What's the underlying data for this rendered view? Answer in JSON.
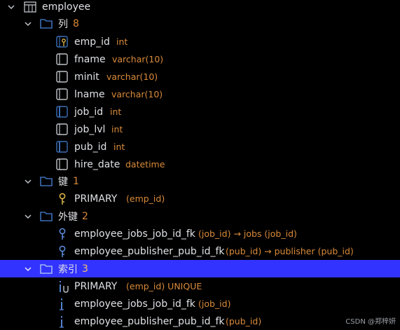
{
  "tree": {
    "table": {
      "name": "employee"
    },
    "columns_group": {
      "label": "列",
      "count": "8",
      "items": [
        {
          "name": "emp_id",
          "type": "int"
        },
        {
          "name": "fname",
          "type": "varchar(10)"
        },
        {
          "name": "minit",
          "type": "varchar(10)"
        },
        {
          "name": "lname",
          "type": "varchar(10)"
        },
        {
          "name": "job_id",
          "type": "int"
        },
        {
          "name": "job_lvl",
          "type": "int"
        },
        {
          "name": "pub_id",
          "type": "int"
        },
        {
          "name": "hire_date",
          "type": "datetime"
        }
      ]
    },
    "keys_group": {
      "label": "键",
      "count": "1",
      "items": [
        {
          "name": "PRIMARY",
          "detail": "(emp_id)"
        }
      ]
    },
    "fks_group": {
      "label": "外键",
      "count": "2",
      "items": [
        {
          "name": "employee_jobs_job_id_fk",
          "detail": "(job_id) → jobs (job_id)"
        },
        {
          "name": "employee_publisher_pub_id_fk",
          "detail": "(pub_id) → publisher (pub_id)"
        }
      ]
    },
    "indexes_group": {
      "label": "索引",
      "count": "3",
      "items": [
        {
          "name": "PRIMARY",
          "detail": "(emp_id) UNIQUE"
        },
        {
          "name": "employee_jobs_job_id_fk",
          "detail": "(job_id)"
        },
        {
          "name": "employee_publisher_pub_id_fk",
          "detail": "(pub_id)"
        }
      ]
    }
  },
  "watermark": "CSDN @郑梓妍",
  "colors": {
    "selection": "#3333ff",
    "meta": "#d98a3a",
    "folder": "#3c6fb6",
    "key": "#e0b84a",
    "fk_key": "#5b8fe0"
  }
}
